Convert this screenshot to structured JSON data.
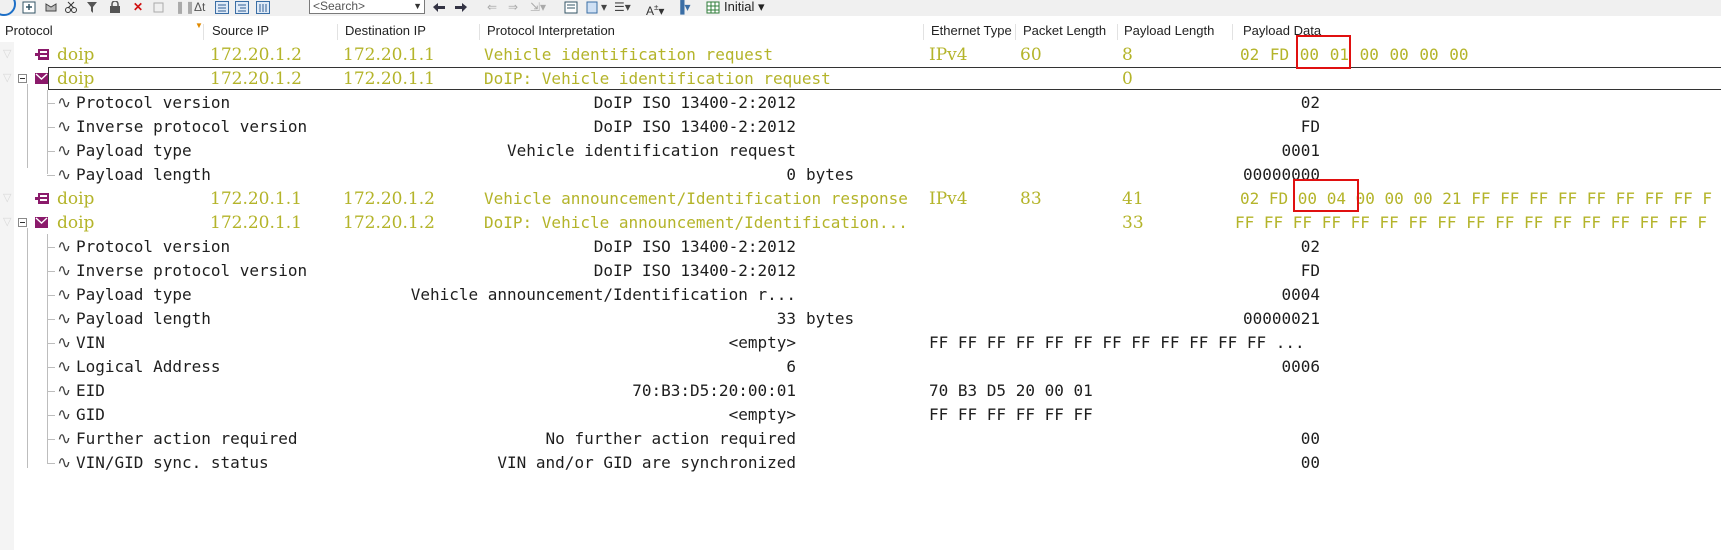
{
  "toolbar": {
    "search_placeholder": "<Search>",
    "initial_label": "Initial"
  },
  "columns": [
    {
      "key": "protocol",
      "label": "Protocol"
    },
    {
      "key": "source_ip",
      "label": "Source IP"
    },
    {
      "key": "dest_ip",
      "label": "Destination IP"
    },
    {
      "key": "interp",
      "label": "Protocol Interpretation"
    },
    {
      "key": "eth_type",
      "label": "Ethernet Type"
    },
    {
      "key": "pkt_len",
      "label": "Packet Length"
    },
    {
      "key": "payload_len",
      "label": "Payload Length"
    },
    {
      "key": "payload_data",
      "label": "Payload Data"
    }
  ],
  "packets": [
    {
      "protocol": "doip",
      "source_ip": "172.20.1.2",
      "dest_ip": "172.20.1.1",
      "interp": "Vehicle identification request",
      "eth_type": "IPv4",
      "pkt_len": "60",
      "payload_len": "8",
      "payload_data": "02 FD 00 01 00 00 00 00"
    },
    {
      "protocol": "doip",
      "source_ip": "172.20.1.2",
      "dest_ip": "172.20.1.1",
      "interp": "DoIP: Vehicle identification request",
      "payload_len": "0",
      "fields": [
        {
          "name": "Protocol version",
          "value": "DoIP ISO 13400-2:2012",
          "raw": "02"
        },
        {
          "name": "Inverse protocol version",
          "value": "DoIP ISO 13400-2:2012",
          "raw": "FD"
        },
        {
          "name": "Payload type",
          "value": "Vehicle identification request",
          "raw": "0001"
        },
        {
          "name": "Payload length",
          "value": "0",
          "unit": "bytes",
          "raw": "00000000"
        }
      ]
    },
    {
      "protocol": "doip",
      "source_ip": "172.20.1.1",
      "dest_ip": "172.20.1.2",
      "interp": "Vehicle announcement/Identification response",
      "eth_type": "IPv4",
      "pkt_len": "83",
      "payload_len": "41",
      "payload_data": "02 FD 00 04 00 00 00 21 FF FF FF FF FF FF FF FF F"
    },
    {
      "protocol": "doip",
      "source_ip": "172.20.1.1",
      "dest_ip": "172.20.1.2",
      "interp": "DoIP: Vehicle announcement/Identification...",
      "payload_len": "33",
      "payload_data": "FF FF FF FF FF FF FF FF FF FF FF FF FF FF FF FF F",
      "fields": [
        {
          "name": "Protocol version",
          "value": "DoIP ISO 13400-2:2012",
          "raw": "02"
        },
        {
          "name": "Inverse protocol version",
          "value": "DoIP ISO 13400-2:2012",
          "raw": "FD"
        },
        {
          "name": "Payload type",
          "value": "Vehicle announcement/Identification r...",
          "raw": "0004"
        },
        {
          "name": "Payload length",
          "value": "33",
          "unit": "bytes",
          "raw": "00000021"
        },
        {
          "name": "VIN",
          "value": "<empty>",
          "hex": "FF FF FF FF FF FF FF FF FF FF FF FF ..."
        },
        {
          "name": "Logical Address",
          "value": "6",
          "raw": "0006"
        },
        {
          "name": "EID",
          "value": "70:B3:D5:20:00:01",
          "hex": "70 B3 D5 20 00 01"
        },
        {
          "name": "GID",
          "value": "<empty>",
          "hex": "FF FF FF FF FF FF"
        },
        {
          "name": "Further action required",
          "value": "No further action required",
          "raw": "00"
        },
        {
          "name": "VIN/GID sync. status",
          "value": "VIN and/or GID are synchronized",
          "raw": "00"
        }
      ]
    }
  ],
  "colors": {
    "packet_text": "#b4b42a",
    "detail_text": "#1e1e1e",
    "highlight_box": "#e01010",
    "row_icon": "#8b1a6b"
  }
}
